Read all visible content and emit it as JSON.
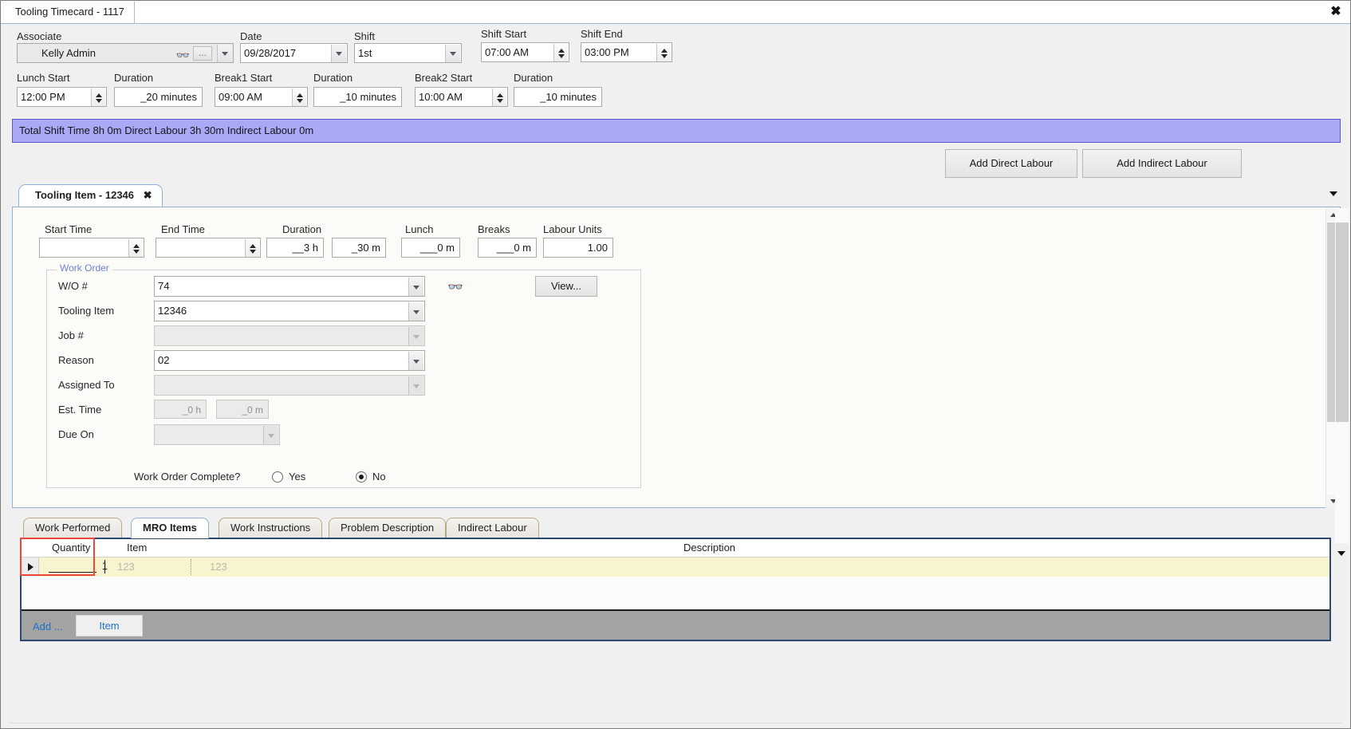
{
  "window": {
    "tab_title": "Tooling Timecard - 1117",
    "close_icon": "close-icon"
  },
  "header": {
    "associate": {
      "label": "Associate",
      "value": "Kelly Admin",
      "find_icon": "binoculars-icon",
      "ellipsis_label": "..."
    },
    "date": {
      "label": "Date",
      "value": "09/28/2017"
    },
    "shift": {
      "label": "Shift",
      "value": "1st"
    },
    "shift_start": {
      "label": "Shift Start",
      "value": "07:00 AM"
    },
    "shift_end": {
      "label": "Shift End",
      "value": "03:00 PM"
    },
    "lunch_start": {
      "label": "Lunch Start",
      "value": "12:00 PM"
    },
    "lunch_duration": {
      "label": "Duration",
      "value": "_20 minutes"
    },
    "break1_start": {
      "label": "Break1 Start",
      "value": "09:00 AM"
    },
    "break1_duration": {
      "label": "Duration",
      "value": "_10 minutes"
    },
    "break2_start": {
      "label": "Break2 Start",
      "value": "10:00 AM"
    },
    "break2_duration": {
      "label": "Duration",
      "value": "_10 minutes"
    }
  },
  "summary": {
    "text": "Total Shift Time 8h 0m  Direct Labour 3h 30m  Indirect Labour 0m",
    "background_color": "#a9a9f5"
  },
  "actions": {
    "add_direct_labour": "Add Direct Labour",
    "add_indirect_labour": "Add Indirect Labour"
  },
  "item_tab": {
    "label": "Tooling Item - 12346",
    "close_glyph": "✖"
  },
  "detail": {
    "start_time": {
      "label": "Start Time",
      "value": ""
    },
    "end_time": {
      "label": "End Time",
      "value": ""
    },
    "duration": {
      "label": "Duration",
      "hours": "__3 h",
      "minutes": "_30 m"
    },
    "lunch": {
      "label": "Lunch",
      "value": "___0 m"
    },
    "breaks": {
      "label": "Breaks",
      "value": "___0 m"
    },
    "labour_units": {
      "label": "Labour Units",
      "value": "1.00"
    },
    "work_order": {
      "title": "Work Order",
      "wo_number": {
        "label": "W/O #",
        "value": "74"
      },
      "tooling_item": {
        "label": "Tooling Item",
        "value": "12346"
      },
      "job_number": {
        "label": "Job #",
        "value": ""
      },
      "reason": {
        "label": "Reason",
        "value": "02"
      },
      "assigned_to": {
        "label": "Assigned To",
        "value": ""
      },
      "est_time": {
        "label": "Est. Time",
        "hours": "_0 h",
        "minutes": "_0 m"
      },
      "due_on": {
        "label": "Due On",
        "value": ""
      },
      "find_icon": "binoculars-icon",
      "view_button": "View..."
    },
    "complete": {
      "label": "Work Order Complete?",
      "yes_label": "Yes",
      "no_label": "No",
      "selected": "No"
    }
  },
  "bottom_tabs": [
    {
      "label": "Work Performed",
      "active": false
    },
    {
      "label": "MRO Items",
      "active": true
    },
    {
      "label": "Work Instructions",
      "active": false
    },
    {
      "label": "Problem Description",
      "active": false
    },
    {
      "label": "Indirect Labour",
      "active": false
    }
  ],
  "grid": {
    "columns": [
      "Quantity",
      "Item",
      "Description"
    ],
    "rows": [
      {
        "quantity": "1",
        "item": "123",
        "description": "123"
      }
    ],
    "footer": {
      "add_label": "Add ...",
      "item_button": "Item"
    },
    "highlight_color": "#f0463c",
    "row_color": "#f7f4ce"
  }
}
